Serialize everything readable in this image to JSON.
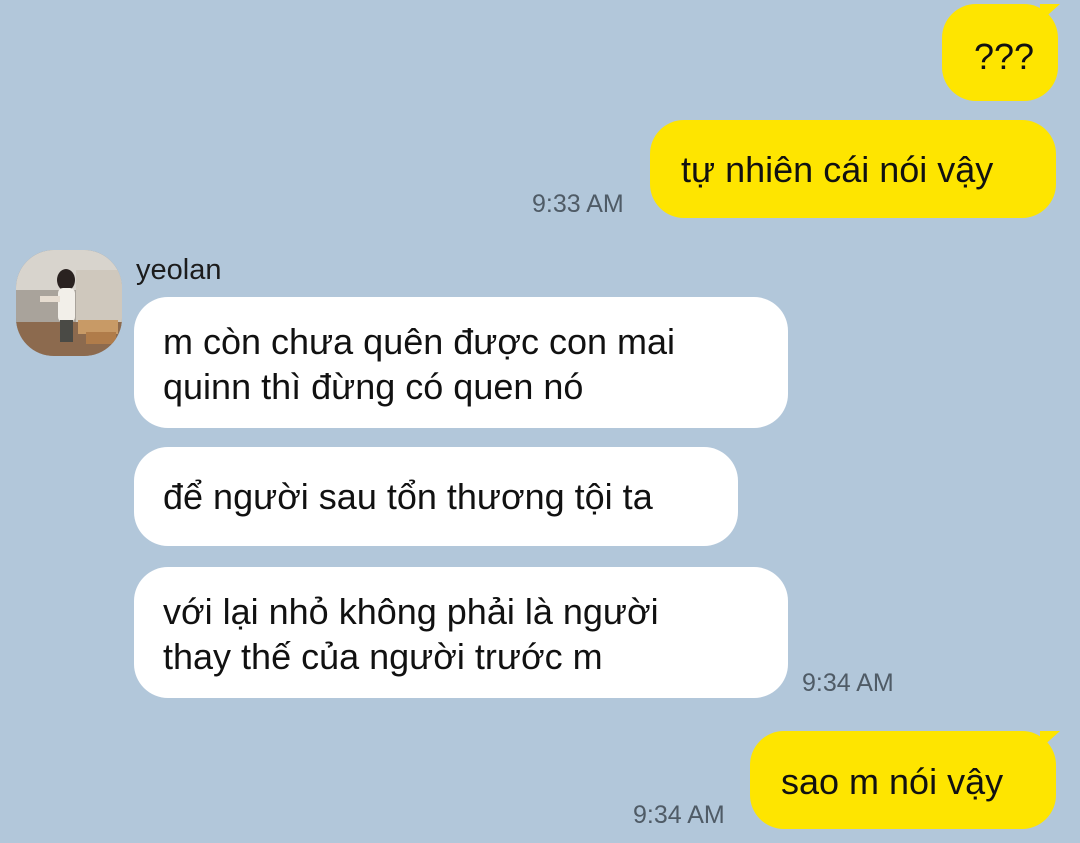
{
  "messages": {
    "out1": "???",
    "out2": "tự nhiên cái nói vậy",
    "time1": "9:33 AM",
    "sender_name": "yeolan",
    "in1_line1": "m còn chưa quên được con mai",
    "in1_line2": "quinn thì đừng có quen nó",
    "in2": "để người sau tổn thương tội ta",
    "in3_line1": "với lại nhỏ không phải là người",
    "in3_line2": "thay thế của người trước m",
    "time2": "9:34 AM",
    "out3": "sao m nói vậy",
    "time3": "9:34 AM"
  },
  "colors": {
    "background": "#b2c7da",
    "outgoing_bubble": "#fee500",
    "incoming_bubble": "#ffffff"
  }
}
